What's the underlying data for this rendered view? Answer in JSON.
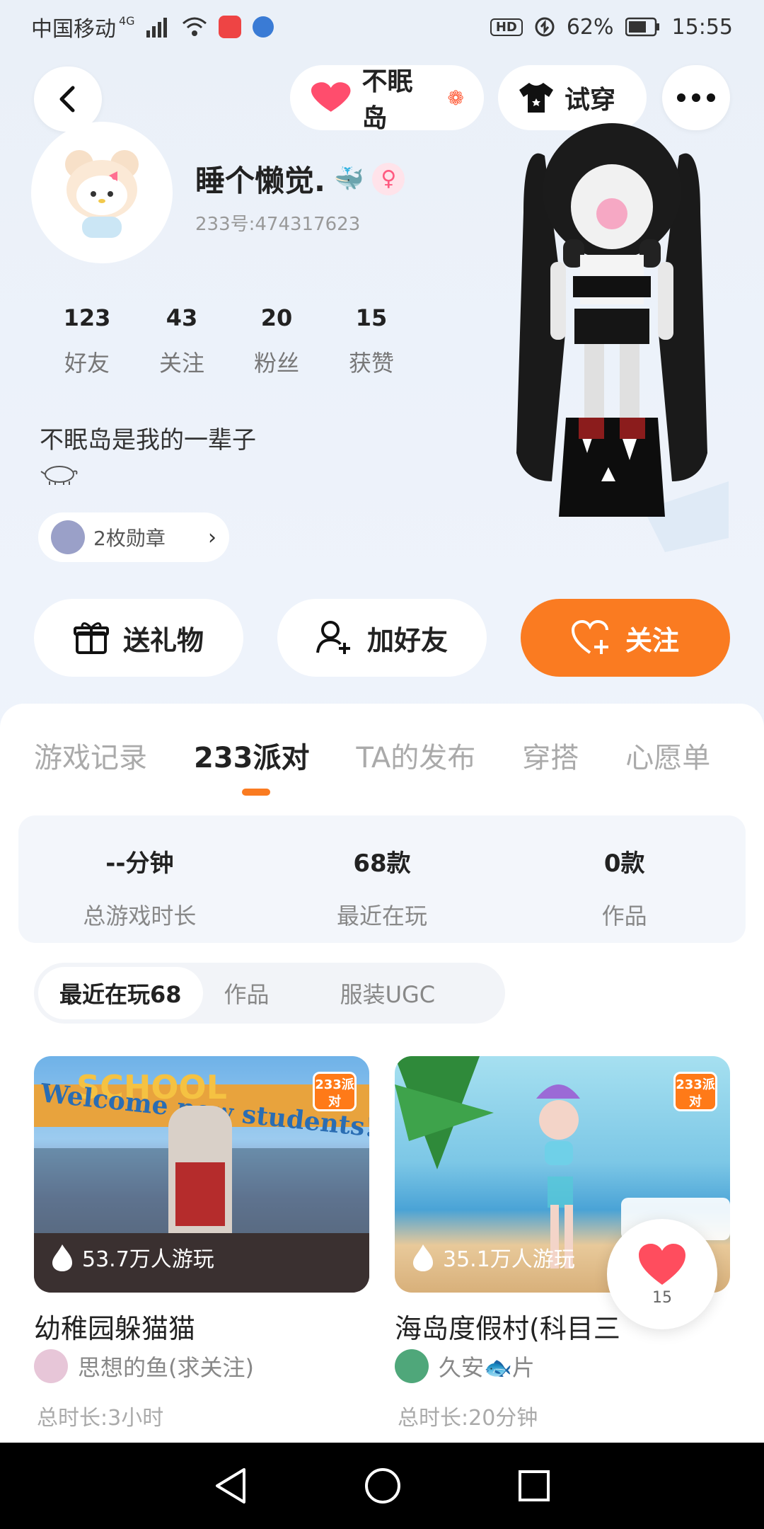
{
  "status_bar": {
    "carrier": "中国移动",
    "network": "4G",
    "hd": "HD",
    "battery": "62%",
    "time": "15:55"
  },
  "header": {
    "island_label": "不眠岛",
    "try_on_label": "试穿"
  },
  "profile": {
    "name": "睡个懒觉.",
    "id_text": "233号:474317623",
    "stats": [
      {
        "value": "123",
        "label": "好友"
      },
      {
        "value": "43",
        "label": "关注"
      },
      {
        "value": "20",
        "label": "粉丝"
      },
      {
        "value": "15",
        "label": "获赞"
      }
    ],
    "bio": "不眠岛是我的一辈子",
    "badges_label": "2枚勋章"
  },
  "actions": {
    "gift": "送礼物",
    "add_friend": "加好友",
    "follow": "关注"
  },
  "tabs": [
    "游戏记录",
    "233派对",
    "TA的发布",
    "穿搭",
    "心愿单"
  ],
  "active_tab": 1,
  "summary": [
    {
      "value": "--分钟",
      "label": "总游戏时长"
    },
    {
      "value": "68款",
      "label": "最近在玩"
    },
    {
      "value": "0款",
      "label": "作品"
    }
  ],
  "subtabs": [
    "最近在玩68",
    "作品",
    "服装UGC"
  ],
  "games": [
    {
      "plays": "53.7万人游玩",
      "title": "幼稚园躲猫猫",
      "author": "思想的鱼(求关注)",
      "duration": "总时长:3小时",
      "banner": "Welcome new students!",
      "sign": "SCHOOL"
    },
    {
      "plays": "35.1万人游玩",
      "title": "海岛度假村(科目三",
      "author": "久安🐟片",
      "duration": "总时长:20分钟"
    }
  ],
  "tag_logo": "233派对",
  "floating_like": {
    "count": "15"
  },
  "colors": {
    "accent": "#fa7b21",
    "heart": "#ff4d5e"
  }
}
